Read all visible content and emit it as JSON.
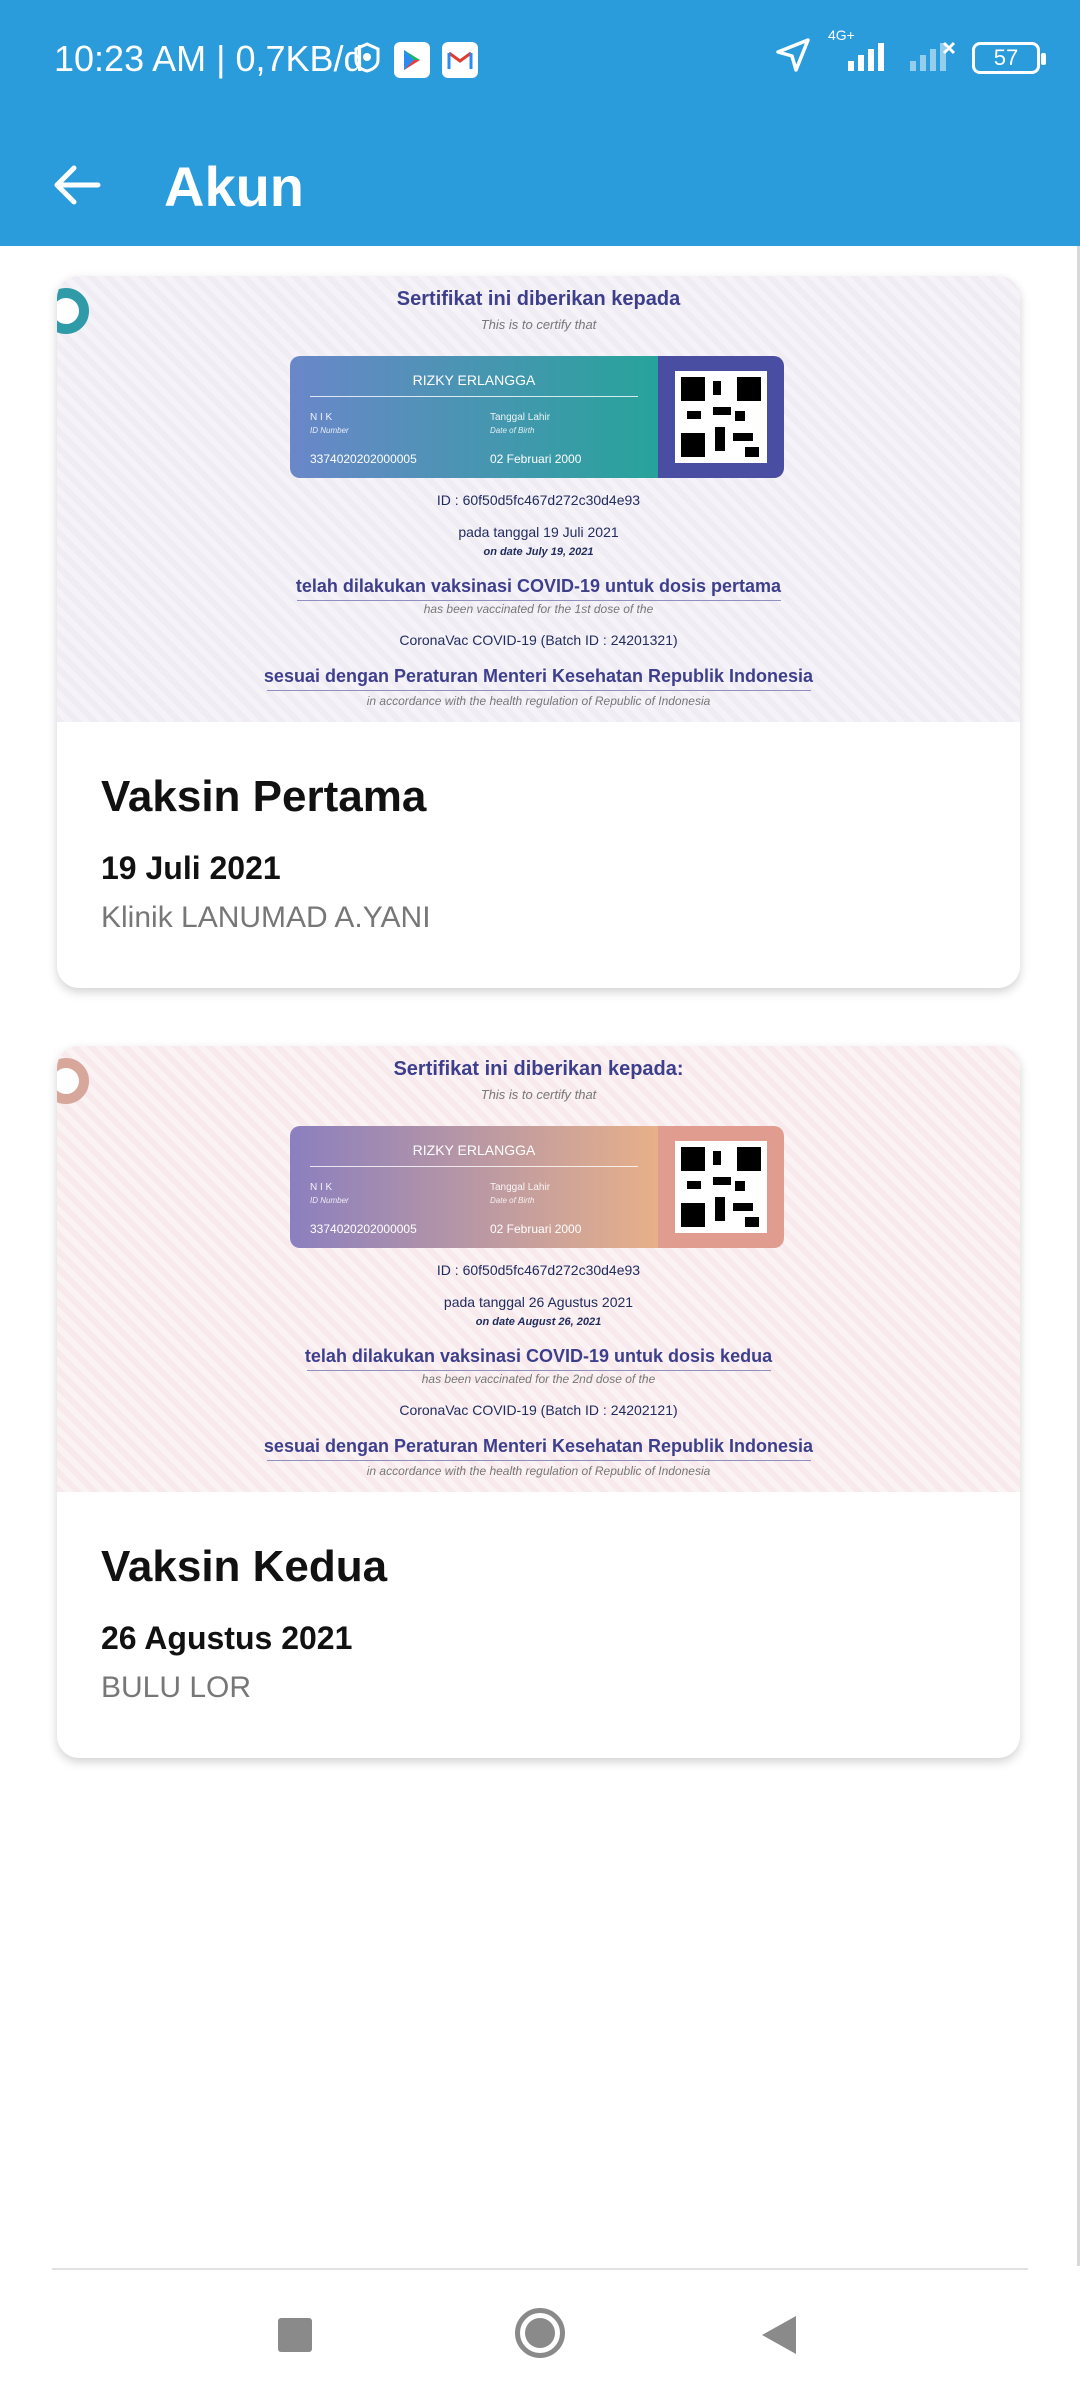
{
  "status_bar": {
    "time_speed": "10:23 AM | 0,7KB/d",
    "network": "4G+",
    "battery": "57",
    "icons": [
      "notification-app-icon",
      "play-store-icon",
      "gmail-icon",
      "location-icon",
      "signal-icon",
      "signal-off-icon",
      "battery-icon"
    ]
  },
  "app_bar": {
    "title": "Akun",
    "back_icon": "arrow-left-icon"
  },
  "cards": [
    {
      "certificate": {
        "title": "Sertifikat ini diberikan kepada",
        "subtitle": "This is to certify that",
        "name": "RIZKY ERLANGGA",
        "nik_label": "N I K",
        "nik_label_en": "ID Number",
        "nik": "3374020202000005",
        "dob_label": "Tanggal Lahir",
        "dob_label_en": "Date of Birth",
        "dob": "02 Februari 2000",
        "id": "ID : 60f50d5fc467d272c30d4e93",
        "date_line": "pada tanggal 19 Juli 2021",
        "date_line_en": "on date July 19, 2021",
        "vacc_line": "telah dilakukan vaksinasi COVID-19 untuk dosis pertama",
        "vacc_line_en": "has been vaccinated for the 1st dose of the",
        "vaccine": "CoronaVac COVID-19 (Batch ID : 24201321)",
        "reg_line": "sesuai dengan Peraturan Menteri Kesehatan Republik Indonesia",
        "reg_line_en": "in accordance with the health regulation of Republic of Indonesia",
        "theme": "teal"
      },
      "title": "Vaksin Pertama",
      "date": "19 Juli 2021",
      "place": "Klinik LANUMAD A.YANI"
    },
    {
      "certificate": {
        "title": "Sertifikat ini diberikan kepada:",
        "subtitle": "This is to certify that",
        "name": "RIZKY ERLANGGA",
        "nik_label": "N I K",
        "nik_label_en": "ID Number",
        "nik": "3374020202000005",
        "dob_label": "Tanggal Lahir",
        "dob_label_en": "Date of Birth",
        "dob": "02 Februari 2000",
        "id": "ID : 60f50d5fc467d272c30d4e93",
        "date_line": "pada tanggal 26 Agustus 2021",
        "date_line_en": "on date August 26, 2021",
        "vacc_line": "telah dilakukan vaksinasi COVID-19 untuk dosis kedua",
        "vacc_line_en": "has been vaccinated for the 2nd dose of the",
        "vaccine": "CoronaVac COVID-19 (Batch ID : 24202121)",
        "reg_line": "sesuai dengan Peraturan Menteri Kesehatan Republik Indonesia",
        "reg_line_en": "in accordance with the health regulation of Republic of Indonesia",
        "theme": "pink"
      },
      "title": "Vaksin Kedua",
      "date": "26 Agustus 2021",
      "place": "BULU LOR"
    }
  ],
  "nav_bar": {
    "icons": [
      "recent-apps-icon",
      "home-icon",
      "back-icon"
    ]
  },
  "colors": {
    "primary": "#2a9bdb",
    "cert_title": "#3d3f8c",
    "teal_card": "#27a39b",
    "pink_card": "#e7b089"
  }
}
